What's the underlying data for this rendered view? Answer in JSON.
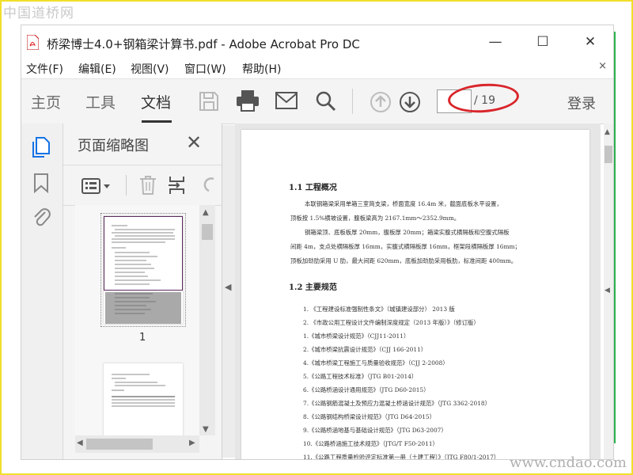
{
  "watermark": {
    "top": "中国道桥网",
    "bottom": "www.cndao.com"
  },
  "window": {
    "title": "桥梁博士4.0+钢箱梁计算书.pdf - Adobe Acrobat Pro DC",
    "controls": [
      "—",
      "☐",
      "✕"
    ]
  },
  "menu": {
    "items": [
      "文件(F)",
      "编辑(E)",
      "视图(V)",
      "窗口(W)",
      "帮助(H)"
    ],
    "close": "×"
  },
  "toolbar": {
    "tabs": [
      "主页",
      "工具",
      "文档"
    ],
    "active_tab": "文档",
    "page_current": "",
    "page_total": "/ 19",
    "login": "登录",
    "icons": [
      "save-icon",
      "print-icon",
      "mail-icon",
      "search-icon",
      "prev-page-icon",
      "next-page-icon"
    ]
  },
  "left_rail": {
    "icons": [
      "pages-icon",
      "bookmark-icon",
      "attachment-icon"
    ]
  },
  "thumbnail_panel": {
    "title": "页面缩略图",
    "close": "✕",
    "tools": [
      "options-icon",
      "delete-icon",
      "insert-icon",
      "undo-icon"
    ],
    "thumbs": [
      {
        "number": "1"
      },
      {
        "number": ""
      }
    ]
  },
  "document": {
    "section1_title": "1.1 工程概况",
    "section1_paras": [
      "本联钢箱梁采用单箱三室简支梁，桥面宽度 16.4m 米，截面底板水平设置，",
      "顶板按 1.5%横坡设置，腹板梁高为 2167.1mm～2352.9mm。",
      "钢箱梁顶、底板板厚 20mm，腹板厚 20mm；箱梁实腹式横隔板和空腹式隔板",
      "间距 4m，支点处横隔板厚 16mm，实腹式横隔板厚 16mm，框架段横隔板厚 16mm；",
      "顶板加劲肋采用 U 肋，最大间距 620mm，底板加劲肋采用板肋，标准间距 400mm。"
    ],
    "section2_title": "1.2 主要规范",
    "section2_items": [
      "1. 《工程建设标准强制性条文》（城镇建设部分）  2013 版",
      "2. 《市政公用工程设计文件编制深度规定（2013 年版）》（修订版）",
      "1.《城市桥梁设计规范》（CJJ11-2011）",
      "2.《城市桥梁抗震设计规范》（CJJ 166-2011）",
      "4.《城市桥梁工程施工与质量验收规范》（CJJ 2-2008）",
      "5.《公路工程技术标准》（JTG B01-2014）",
      "6.《公路桥涵设计通用规范》（JTG D60-2015）",
      "7.《公路钢筋混凝土及预应力混凝土桥涵设计规范》（JTG 3362-2018）",
      "8.《公路钢结构桥梁设计规范》（JTG D64-2015）",
      "9.《公路桥涵地基与基础设计规范》（JTG D63-2007）",
      "10.《公路桥涵施工技术规范》（JTG/T F50-2011）",
      "11.《公路工程质量检验评定标准第一册（土建工程）》（JTG F80/1-2017）"
    ]
  }
}
